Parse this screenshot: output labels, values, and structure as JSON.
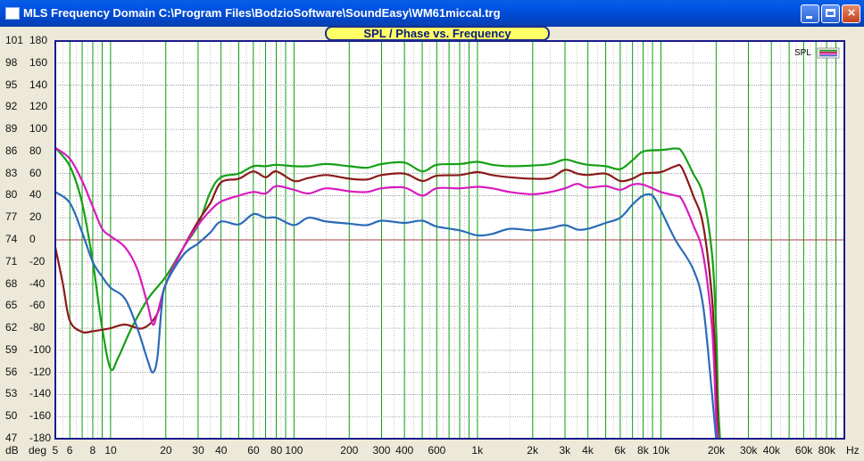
{
  "window": {
    "title": "MLS Frequency Domain  C:\\Program Files\\BodzioSoftware\\SoundEasy\\WM61miccal.trg",
    "buttons": {
      "minimize": "minimize",
      "maximize": "maximize",
      "close": "×"
    }
  },
  "chart_data": {
    "type": "line",
    "title": "SPL / Phase vs. Frequency",
    "legend_label": "SPL",
    "x_scale": "log",
    "xlim": [
      5,
      100000
    ],
    "x_ticks": [
      {
        "v": 5,
        "l": "5"
      },
      {
        "v": 6,
        "l": "6"
      },
      {
        "v": 8,
        "l": "8"
      },
      {
        "v": 10,
        "l": "10"
      },
      {
        "v": 20,
        "l": "20"
      },
      {
        "v": 30,
        "l": "30"
      },
      {
        "v": 40,
        "l": "40"
      },
      {
        "v": 60,
        "l": "60"
      },
      {
        "v": 80,
        "l": "80"
      },
      {
        "v": 100,
        "l": "100"
      },
      {
        "v": 200,
        "l": "200"
      },
      {
        "v": 300,
        "l": "300"
      },
      {
        "v": 400,
        "l": "400"
      },
      {
        "v": 600,
        "l": "600"
      },
      {
        "v": 1000,
        "l": "1k"
      },
      {
        "v": 2000,
        "l": "2k"
      },
      {
        "v": 3000,
        "l": "3k"
      },
      {
        "v": 4000,
        "l": "4k"
      },
      {
        "v": 6000,
        "l": "6k"
      },
      {
        "v": 8000,
        "l": "8k"
      },
      {
        "v": 10000,
        "l": "10k"
      },
      {
        "v": 20000,
        "l": "20k"
      },
      {
        "v": 30000,
        "l": "30k"
      },
      {
        "v": 40000,
        "l": "40k"
      },
      {
        "v": 60000,
        "l": "60k"
      },
      {
        "v": 80000,
        "l": "80k"
      }
    ],
    "x_unit": "Hz",
    "y_db_label": "dB",
    "y_deg_label": "deg",
    "ylim_db": [
      47,
      101
    ],
    "ylim_deg": [
      -180,
      180
    ],
    "y_ticks_db": [
      "101",
      "98",
      "95",
      "92",
      "89",
      "86",
      "83",
      "80",
      "77",
      "74",
      "71",
      "68",
      "65",
      "62",
      "59",
      "56",
      "53",
      "50",
      "47"
    ],
    "y_ticks_deg": [
      "180",
      "160",
      "140",
      "120",
      "100",
      "80",
      "60",
      "40",
      "20",
      "0",
      "-20",
      "-40",
      "-60",
      "-80",
      "-100",
      "-120",
      "-140",
      "-160",
      "-180"
    ],
    "reference_line_db": 74,
    "grid": true,
    "colors": {
      "background": "#ffffff",
      "grid": "#0aa00a",
      "frame": "#1a1a8c",
      "reference": "#a04040"
    },
    "series": [
      {
        "color": "#16a016",
        "points": [
          [
            5,
            86.5
          ],
          [
            6,
            84
          ],
          [
            7,
            79
          ],
          [
            8,
            71
          ],
          [
            9,
            62
          ],
          [
            10,
            56.5
          ],
          [
            11,
            58
          ],
          [
            13,
            62
          ],
          [
            16,
            66
          ],
          [
            20,
            69
          ],
          [
            25,
            73
          ],
          [
            30,
            76
          ],
          [
            35,
            80.5
          ],
          [
            40,
            82.5
          ],
          [
            50,
            83
          ],
          [
            60,
            84
          ],
          [
            70,
            84
          ],
          [
            80,
            84.2
          ],
          [
            100,
            84
          ],
          [
            120,
            84
          ],
          [
            150,
            84.3
          ],
          [
            200,
            84
          ],
          [
            250,
            83.8
          ],
          [
            300,
            84.3
          ],
          [
            400,
            84.5
          ],
          [
            500,
            83.3
          ],
          [
            600,
            84.2
          ],
          [
            800,
            84.3
          ],
          [
            1000,
            84.6
          ],
          [
            1200,
            84.2
          ],
          [
            1500,
            84
          ],
          [
            2000,
            84.1
          ],
          [
            2500,
            84.3
          ],
          [
            3000,
            84.9
          ],
          [
            3500,
            84.5
          ],
          [
            4000,
            84.2
          ],
          [
            5000,
            84
          ],
          [
            6000,
            83.6
          ],
          [
            7000,
            84.8
          ],
          [
            8000,
            86
          ],
          [
            10000,
            86.2
          ],
          [
            11000,
            86.3
          ],
          [
            12000,
            86.4
          ],
          [
            13000,
            86
          ],
          [
            15000,
            83
          ],
          [
            17000,
            80
          ],
          [
            19000,
            72
          ],
          [
            20000,
            62
          ],
          [
            20500,
            52
          ],
          [
            21000,
            47
          ]
        ]
      },
      {
        "color": "#8b1a1a",
        "points": [
          [
            5,
            73
          ],
          [
            5.5,
            68
          ],
          [
            6,
            63
          ],
          [
            7,
            61.5
          ],
          [
            8,
            61.6
          ],
          [
            9,
            61.8
          ],
          [
            10,
            62
          ],
          [
            12,
            62.5
          ],
          [
            15,
            62
          ],
          [
            18,
            64
          ],
          [
            20,
            68
          ],
          [
            25,
            73
          ],
          [
            30,
            76.5
          ],
          [
            35,
            79
          ],
          [
            40,
            81.8
          ],
          [
            50,
            82.3
          ],
          [
            60,
            83.3
          ],
          [
            70,
            82.5
          ],
          [
            80,
            83.3
          ],
          [
            100,
            82
          ],
          [
            120,
            82.4
          ],
          [
            150,
            82.8
          ],
          [
            200,
            82.3
          ],
          [
            250,
            82.2
          ],
          [
            300,
            82.8
          ],
          [
            400,
            83
          ],
          [
            500,
            82
          ],
          [
            600,
            82.7
          ],
          [
            800,
            82.8
          ],
          [
            1000,
            83.2
          ],
          [
            1200,
            82.8
          ],
          [
            1500,
            82.5
          ],
          [
            2000,
            82.3
          ],
          [
            2500,
            82.4
          ],
          [
            3000,
            83.5
          ],
          [
            3500,
            83
          ],
          [
            4000,
            82.8
          ],
          [
            5000,
            83
          ],
          [
            6000,
            82
          ],
          [
            7000,
            82.3
          ],
          [
            8000,
            83
          ],
          [
            10000,
            83.2
          ],
          [
            12000,
            84
          ],
          [
            13000,
            83.8
          ],
          [
            15000,
            80
          ],
          [
            17000,
            76
          ],
          [
            19000,
            66
          ],
          [
            20000,
            55
          ],
          [
            20500,
            47
          ]
        ]
      },
      {
        "color": "#d81bc0",
        "points": [
          [
            5,
            86.5
          ],
          [
            6,
            85
          ],
          [
            7,
            82
          ],
          [
            8,
            78.5
          ],
          [
            9,
            75.5
          ],
          [
            10,
            74.5
          ],
          [
            12,
            73
          ],
          [
            14,
            70
          ],
          [
            16,
            65
          ],
          [
            17,
            62.5
          ],
          [
            18,
            64
          ],
          [
            20,
            68
          ],
          [
            25,
            73
          ],
          [
            30,
            76
          ],
          [
            35,
            78
          ],
          [
            40,
            79.2
          ],
          [
            50,
            80
          ],
          [
            60,
            80.5
          ],
          [
            70,
            80.3
          ],
          [
            80,
            81.3
          ],
          [
            100,
            80.8
          ],
          [
            120,
            80.3
          ],
          [
            150,
            81
          ],
          [
            200,
            80.6
          ],
          [
            250,
            80.5
          ],
          [
            300,
            81
          ],
          [
            400,
            81.1
          ],
          [
            500,
            80
          ],
          [
            600,
            81
          ],
          [
            800,
            81
          ],
          [
            1000,
            81.2
          ],
          [
            1200,
            81
          ],
          [
            1500,
            80.5
          ],
          [
            2000,
            80.2
          ],
          [
            2500,
            80.5
          ],
          [
            3000,
            81
          ],
          [
            3500,
            81.6
          ],
          [
            4000,
            81.1
          ],
          [
            5000,
            81.3
          ],
          [
            6000,
            80.8
          ],
          [
            7000,
            81.5
          ],
          [
            8000,
            81.5
          ],
          [
            10000,
            80.5
          ],
          [
            12000,
            80
          ],
          [
            13000,
            79.5
          ],
          [
            15000,
            76
          ],
          [
            17000,
            72
          ],
          [
            19000,
            62
          ],
          [
            20000,
            50
          ],
          [
            20500,
            47
          ]
        ]
      },
      {
        "color": "#2b6cb8",
        "points": [
          [
            5,
            80.5
          ],
          [
            6,
            79
          ],
          [
            7,
            75
          ],
          [
            8,
            71
          ],
          [
            9,
            69
          ],
          [
            10,
            67.5
          ],
          [
            12,
            66
          ],
          [
            14,
            62
          ],
          [
            16,
            57.5
          ],
          [
            17,
            56
          ],
          [
            18,
            58
          ],
          [
            19,
            65
          ],
          [
            20,
            68
          ],
          [
            25,
            72
          ],
          [
            30,
            73.5
          ],
          [
            35,
            75
          ],
          [
            40,
            76.5
          ],
          [
            50,
            76.1
          ],
          [
            60,
            77.5
          ],
          [
            70,
            77
          ],
          [
            80,
            77
          ],
          [
            100,
            76
          ],
          [
            120,
            77
          ],
          [
            150,
            76.5
          ],
          [
            200,
            76.2
          ],
          [
            250,
            76
          ],
          [
            300,
            76.6
          ],
          [
            400,
            76.3
          ],
          [
            500,
            76.6
          ],
          [
            600,
            75.8
          ],
          [
            800,
            75.3
          ],
          [
            1000,
            74.6
          ],
          [
            1200,
            74.8
          ],
          [
            1500,
            75.5
          ],
          [
            2000,
            75.3
          ],
          [
            2500,
            75.6
          ],
          [
            3000,
            76
          ],
          [
            3500,
            75.4
          ],
          [
            4000,
            75.5
          ],
          [
            5000,
            76.3
          ],
          [
            6000,
            77
          ],
          [
            7000,
            78.8
          ],
          [
            8000,
            80
          ],
          [
            9000,
            80
          ],
          [
            10000,
            78
          ],
          [
            12000,
            74
          ],
          [
            15000,
            70
          ],
          [
            17000,
            65
          ],
          [
            19000,
            53
          ],
          [
            20000,
            47
          ]
        ]
      }
    ]
  }
}
